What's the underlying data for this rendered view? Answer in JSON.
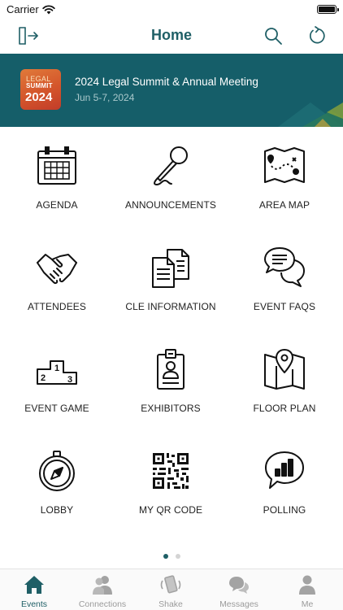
{
  "status_bar": {
    "carrier": "Carrier"
  },
  "nav": {
    "title": "Home",
    "left_icon": "exit-icon",
    "right_icons": [
      "search-icon",
      "refresh-icon"
    ]
  },
  "banner": {
    "logo": {
      "line1": "LEGAL",
      "line2": "SUMMIT",
      "line3": "2024"
    },
    "title": "2024 Legal Summit & Annual Meeting",
    "date": "Jun 5-7, 2024"
  },
  "grid": {
    "items": [
      {
        "label": "AGENDA",
        "icon": "calendar-icon"
      },
      {
        "label": "ANNOUNCEMENTS",
        "icon": "microphone-icon"
      },
      {
        "label": "AREA MAP",
        "icon": "map-route-icon"
      },
      {
        "label": "ATTENDEES",
        "icon": "handshake-icon"
      },
      {
        "label": "CLE INFORMATION",
        "icon": "documents-icon"
      },
      {
        "label": "EVENT FAQS",
        "icon": "chat-bubbles-icon"
      },
      {
        "label": "EVENT GAME",
        "icon": "podium-icon"
      },
      {
        "label": "EXHIBITORS",
        "icon": "badge-icon"
      },
      {
        "label": "FLOOR PLAN",
        "icon": "map-pin-icon"
      },
      {
        "label": "LOBBY",
        "icon": "compass-icon"
      },
      {
        "label": "MY QR CODE",
        "icon": "qr-code-icon"
      },
      {
        "label": "POLLING",
        "icon": "poll-chart-icon"
      }
    ]
  },
  "pager": {
    "pages": 2,
    "active": 1
  },
  "tabbar": {
    "tabs": [
      {
        "label": "Events",
        "icon": "home-icon",
        "active": true
      },
      {
        "label": "Connections",
        "icon": "people-icon",
        "active": false
      },
      {
        "label": "Shake",
        "icon": "shake-phone-icon",
        "active": false
      },
      {
        "label": "Messages",
        "icon": "chat-icon",
        "active": false
      },
      {
        "label": "Me",
        "icon": "person-icon",
        "active": false
      }
    ]
  },
  "colors": {
    "accent": "#1f5f66",
    "banner_bg": "#155e69",
    "inactive_tab": "#9b9b9b"
  }
}
